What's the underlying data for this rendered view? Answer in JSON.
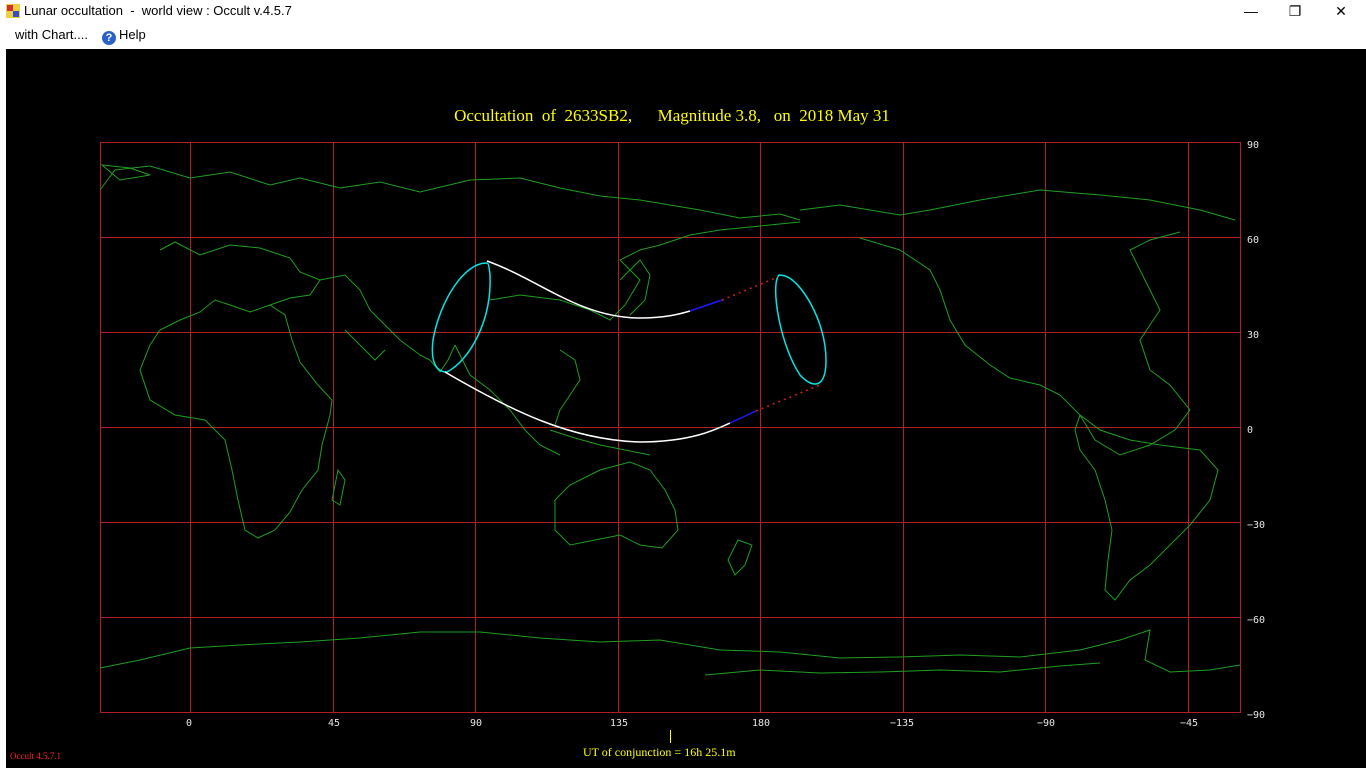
{
  "window": {
    "title": "Lunar occultation  -  world view : Occult v.4.5.7",
    "minimize": "—",
    "maximize": "❐",
    "close": "✕"
  },
  "menu": {
    "chart": "with Chart....",
    "help": "Help"
  },
  "map": {
    "title": "Occultation  of  2633SB2,      Magnitude 3.8,   on  2018 May 31",
    "longitude_ticks": [
      "0",
      "45",
      "90",
      "135",
      "180",
      "−135",
      "−90",
      "−45"
    ],
    "latitude_ticks": [
      "90",
      "60",
      "30",
      "0",
      "−30",
      "−60",
      "−90"
    ],
    "conjunction": "UT of conjunction = 16h 25.1m",
    "version": "Occult 4.5.7.1",
    "colors": {
      "background": "#000000",
      "grid": "#b02020",
      "coastline": "#1f9e1f",
      "limit_curve": "#00e5e5",
      "path": "#ffffff",
      "path_day": "#1a1aff",
      "path_dotted": "#d02020",
      "title": "#ffff00"
    }
  }
}
